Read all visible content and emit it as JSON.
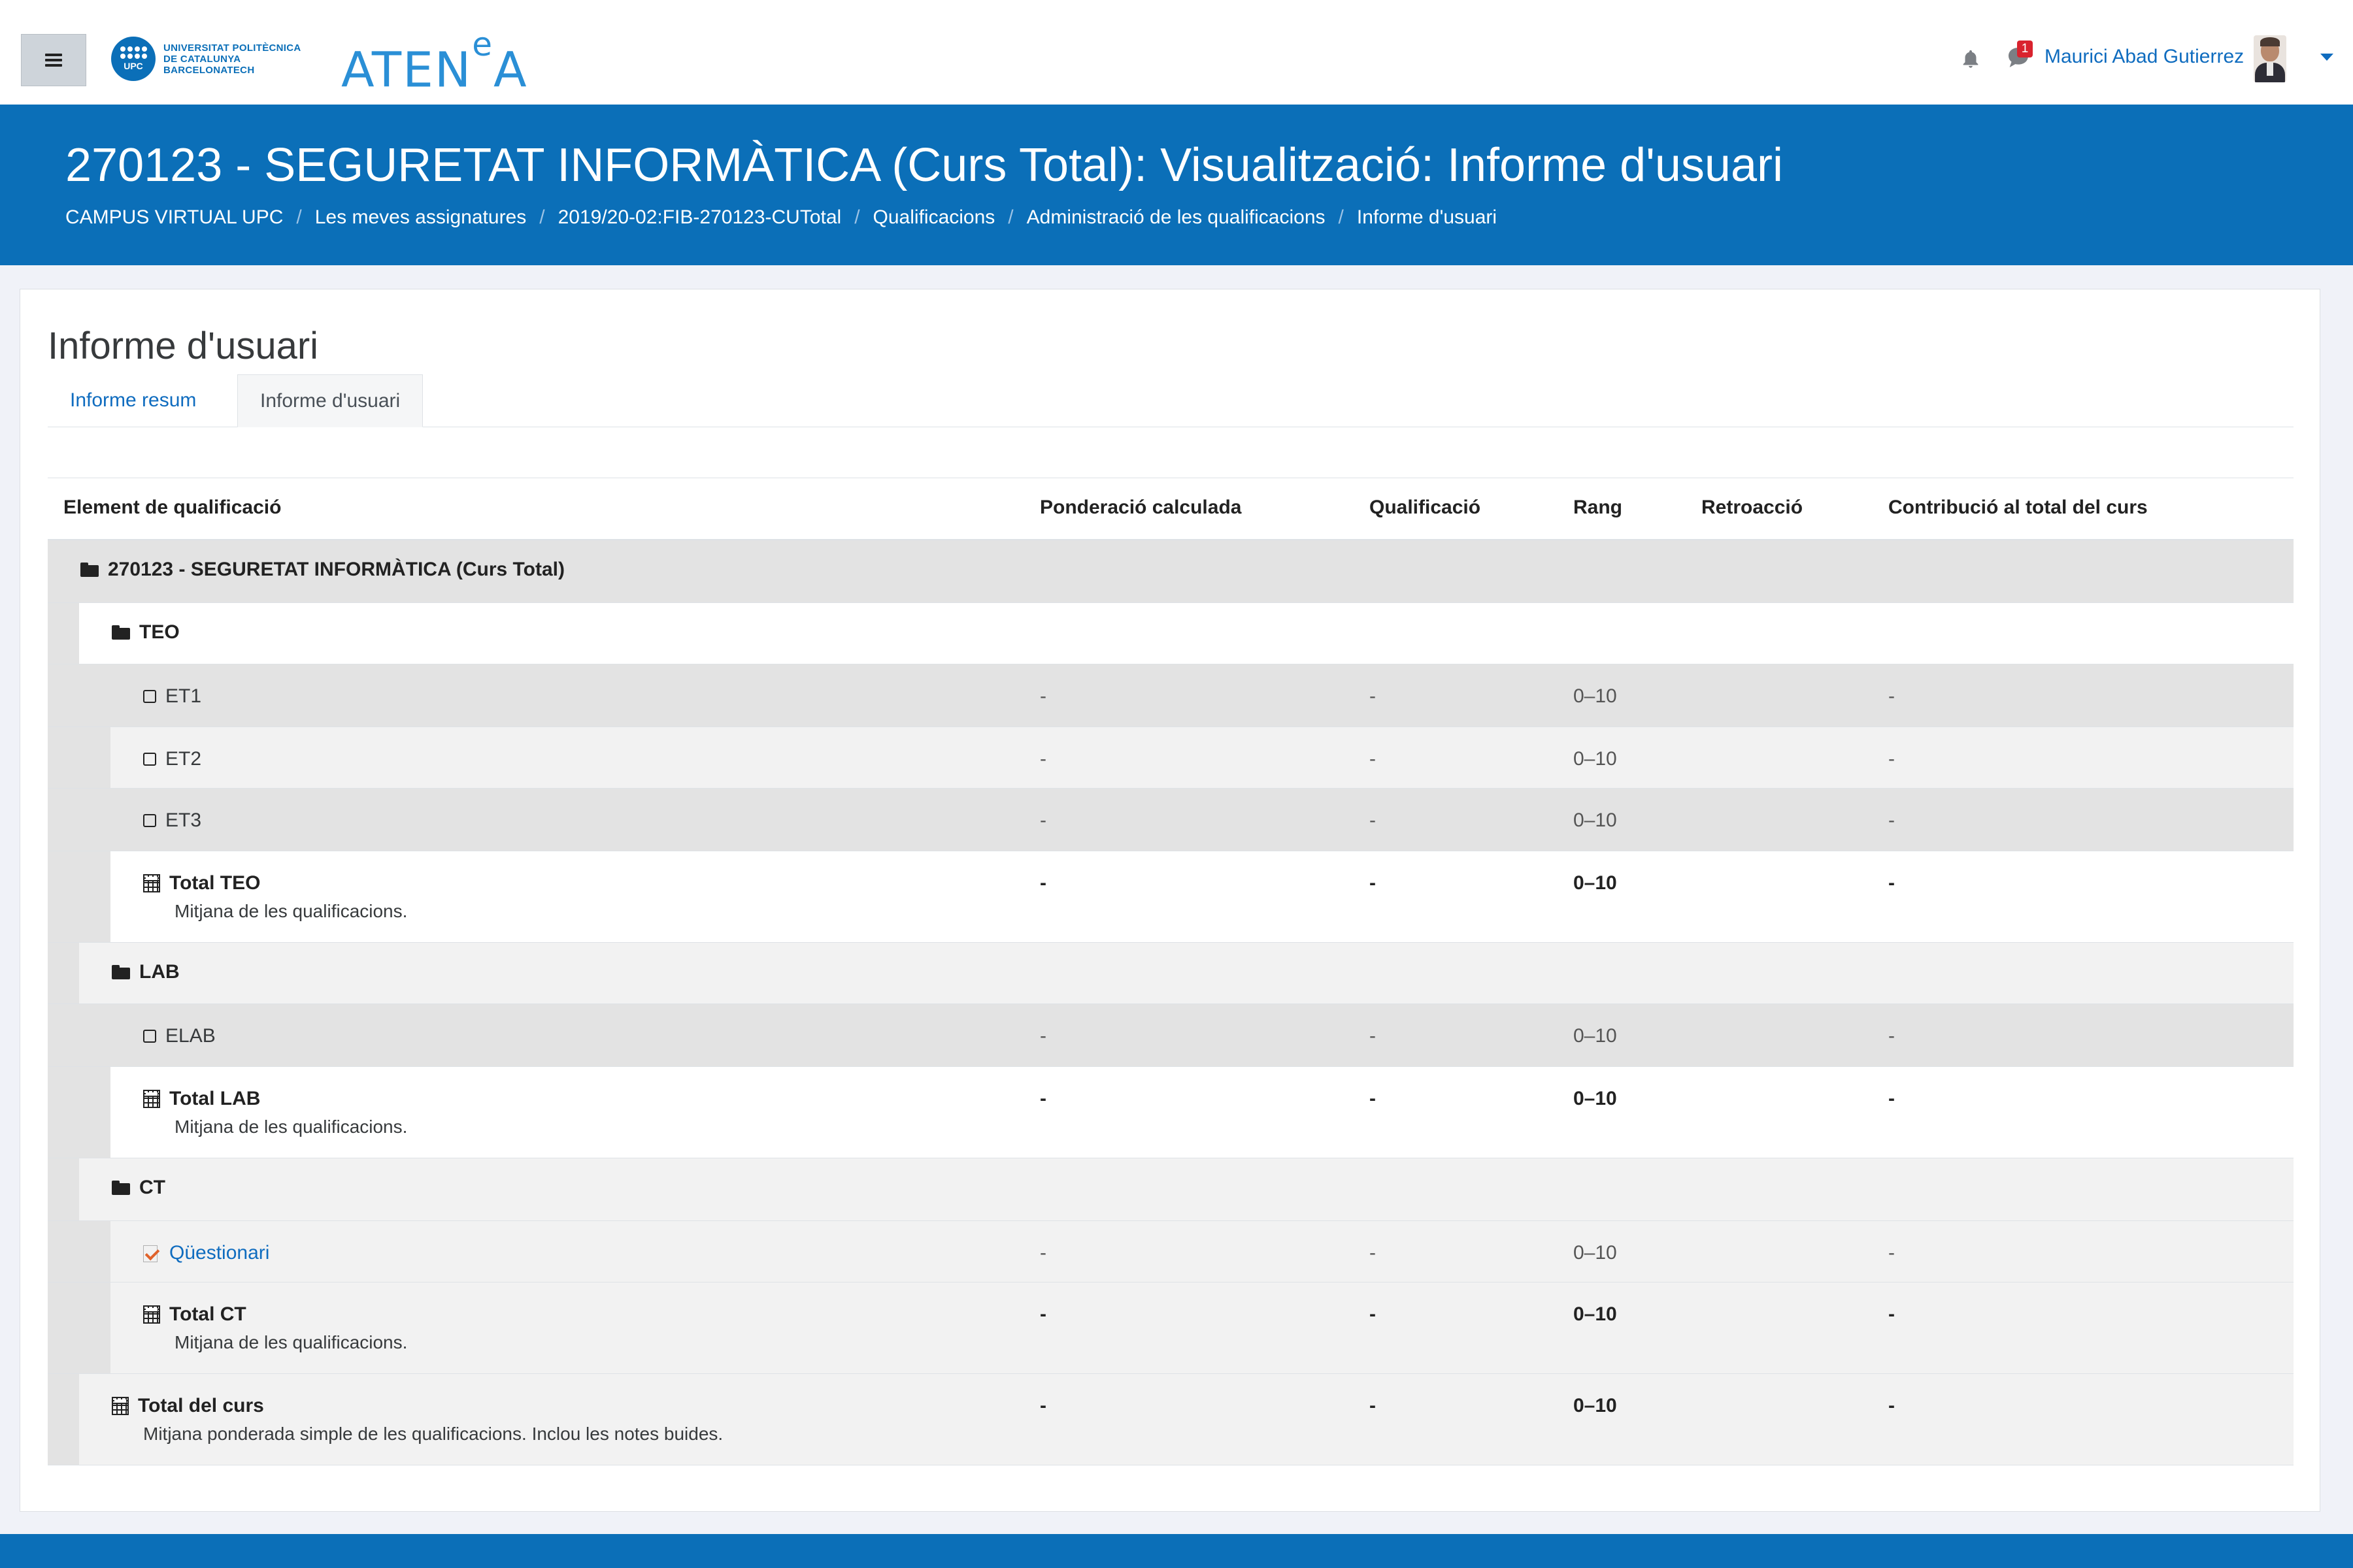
{
  "navbar": {
    "menu_icon": "hamburger-icon",
    "university_logo": "UNIVERSITAT POLITÈCNICA DE CATALUNYA BARCELONATECH",
    "university_logo_lines": [
      "UNIVERSITAT POLITÈCNICA",
      "DE CATALUNYA",
      "BARCELONATECH"
    ],
    "university_seal_text": "UPC",
    "brand": "ATENeA",
    "brand_main": "ATEN",
    "brand_sup": "e",
    "brand_tail": "A",
    "notifications_icon": "bell-icon",
    "messages_icon": "message-icon",
    "messages_badge": "1",
    "user_name": "Maurici Abad Gutierrez",
    "user_menu_icon": "caret-down-icon"
  },
  "header": {
    "title": "270123 - SEGURETAT INFORMÀTICA (Curs Total): Visualització: Informe d'usuari",
    "breadcrumb": [
      "CAMPUS VIRTUAL UPC",
      "Les meves assignatures",
      "2019/20-02:FIB-270123-CUTotal",
      "Qualificacions",
      "Administració de les qualificacions",
      "Informe d'usuari"
    ],
    "breadcrumb_separator": "/"
  },
  "report": {
    "title": "Informe d'usuari",
    "tabs": [
      {
        "label": "Informe resum",
        "active": false
      },
      {
        "label": "Informe d'usuari",
        "active": true
      }
    ],
    "columns": [
      "Element de qualificació",
      "Ponderació calculada",
      "Qualificació",
      "Rang",
      "Retroacció",
      "Contribució al total del curs"
    ],
    "rows": [
      {
        "type": "category",
        "name": "270123 - SEGURETAT INFORMÀTICA (Curs Total)",
        "icon": "folder-icon"
      },
      {
        "type": "category",
        "name": "TEO",
        "icon": "folder-icon"
      },
      {
        "type": "item",
        "name": "ET1",
        "icon": "checkbox-icon",
        "weight": "-",
        "grade": "-",
        "range": "0–10",
        "feedback": "",
        "contribution": "-"
      },
      {
        "type": "item",
        "name": "ET2",
        "icon": "checkbox-icon",
        "weight": "-",
        "grade": "-",
        "range": "0–10",
        "feedback": "",
        "contribution": "-"
      },
      {
        "type": "item",
        "name": "ET3",
        "icon": "checkbox-icon",
        "weight": "-",
        "grade": "-",
        "range": "0–10",
        "feedback": "",
        "contribution": "-"
      },
      {
        "type": "total",
        "name": "Total TEO",
        "sub": "Mitjana de les qualificacions.",
        "icon": "calculator-icon",
        "weight": "-",
        "grade": "-",
        "range": "0–10",
        "feedback": "",
        "contribution": "-"
      },
      {
        "type": "category",
        "name": "LAB",
        "icon": "folder-icon"
      },
      {
        "type": "item",
        "name": "ELAB",
        "icon": "checkbox-icon",
        "weight": "-",
        "grade": "-",
        "range": "0–10",
        "feedback": "",
        "contribution": "-"
      },
      {
        "type": "total",
        "name": "Total LAB",
        "sub": "Mitjana de les qualificacions.",
        "icon": "calculator-icon",
        "weight": "-",
        "grade": "-",
        "range": "0–10",
        "feedback": "",
        "contribution": "-"
      },
      {
        "type": "category",
        "name": "CT",
        "icon": "folder-icon"
      },
      {
        "type": "item",
        "name": "Qüestionari",
        "icon": "quiz-icon",
        "link": true,
        "weight": "-",
        "grade": "-",
        "range": "0–10",
        "feedback": "",
        "contribution": "-"
      },
      {
        "type": "total",
        "name": "Total CT",
        "sub": "Mitjana de les qualificacions.",
        "icon": "calculator-icon",
        "weight": "-",
        "grade": "-",
        "range": "0–10",
        "feedback": "",
        "contribution": "-"
      },
      {
        "type": "total",
        "name": "Total del curs",
        "sub": "Mitjana ponderada simple de les qualificacions. Inclou les notes buides.",
        "icon": "calculator-icon",
        "weight": "-",
        "grade": "-",
        "range": "0–10",
        "feedback": "",
        "contribution": "-"
      }
    ]
  },
  "colors": {
    "brand_blue": "#0b6fb8",
    "link_blue": "#0f6cbf",
    "page_background": "#f0f2f8",
    "row_dark": "#e3e3e3",
    "row_light": "#f2f2f2",
    "badge_red": "#d9232e"
  }
}
